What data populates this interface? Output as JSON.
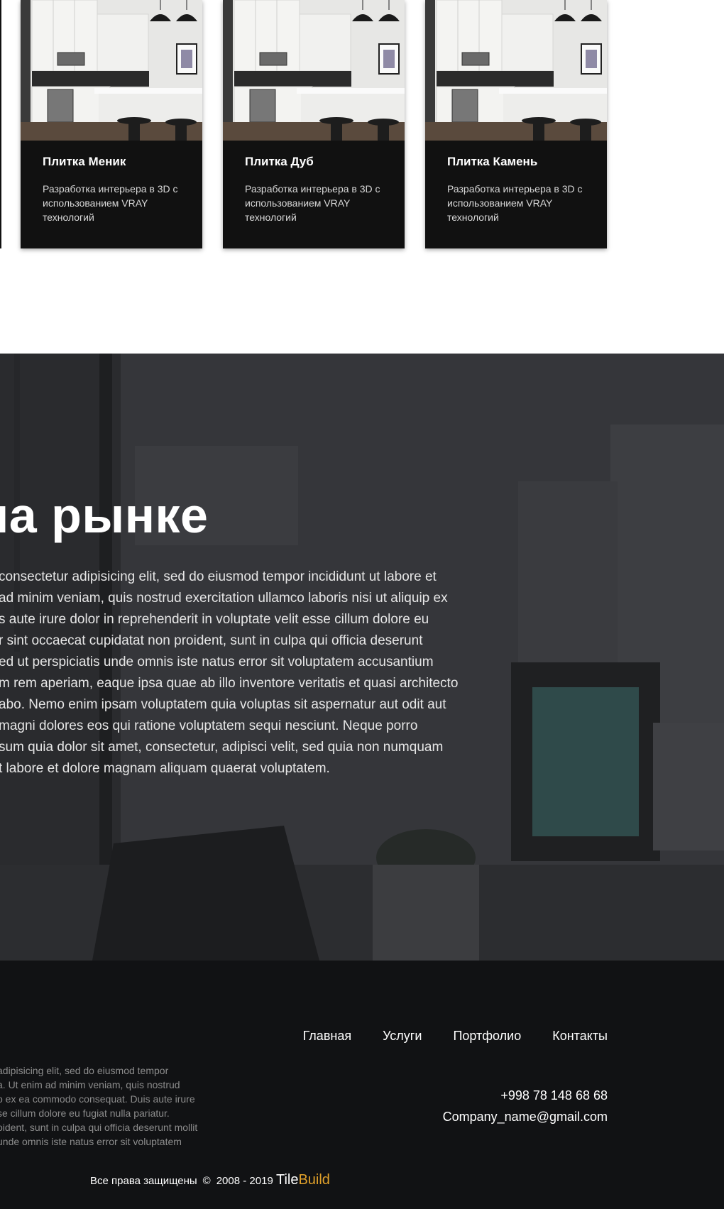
{
  "cards": [
    {
      "title": "Плитка Меник",
      "text": "Разработка интерьера в 3D с использованием VRAY технологий"
    },
    {
      "title": "Плитка Дуб",
      "text": "Разработка интерьера в 3D с использованием VRAY технологий"
    },
    {
      "title": "Плитка Камень",
      "text": "Разработка интерьера в 3D с использованием VRAY технологий"
    }
  ],
  "hero": {
    "title": "на рынке",
    "lines": [
      "consectetur adipisicing elit, sed do eiusmod tempor incididunt ut labore et",
      "ad minim veniam, quis nostrud exercitation ullamco laboris nisi ut aliquip ex",
      "s aute irure dolor in reprehenderit in voluptate velit esse cillum dolore eu",
      "r sint occaecat cupidatat non proident, sunt in culpa qui officia deserunt",
      "ed ut perspiciatis unde omnis iste natus error sit voluptatem accusantium",
      "m rem aperiam, eaque ipsa quae ab illo inventore veritatis et quasi architecto",
      "abo. Nemo enim ipsam voluptatem quia voluptas sit aspernatur aut odit aut",
      "magni dolores eos qui ratione voluptatem sequi nesciunt. Neque porro",
      "sum quia dolor sit amet, consectetur, adipisci velit, sed quia non numquam",
      "t labore et dolore magnam aliquam quaerat voluptatem."
    ]
  },
  "footer": {
    "nav": [
      "Главная",
      "Услуги",
      "Портфолио",
      "Контакты"
    ],
    "desc_lines": [
      "adipisicing elit, sed do eiusmod tempor",
      "a. Ut enim ad minim veniam, quis nostrud",
      "o ex ea commodo consequat. Duis aute irure",
      "se cillum dolore eu fugiat nulla pariatur.",
      "oident, sunt in culpa qui officia deserunt mollit",
      "unde omnis iste natus error sit voluptatem"
    ],
    "phone": "+998 78 148 68 68",
    "email": "Company_name@gmail.com",
    "rights": "Все права защищены",
    "copy_symbol": "©",
    "years": "2008 - 2019",
    "brand_a": "Tile",
    "brand_b": "Build"
  }
}
